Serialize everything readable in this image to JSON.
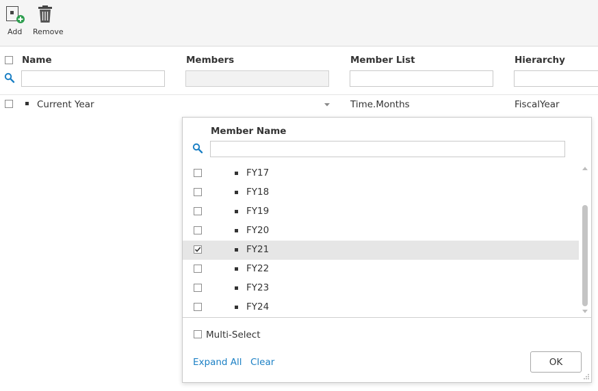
{
  "toolbar": {
    "add_label": "Add",
    "remove_label": "Remove"
  },
  "grid": {
    "columns": [
      "Name",
      "Members",
      "Member List",
      "Hierarchy"
    ],
    "row": {
      "name": "Current Year",
      "members": "",
      "member_list": "Time.Months",
      "hierarchy": "FiscalYear"
    }
  },
  "popup": {
    "title": "Member Name",
    "search_value": "",
    "items": [
      {
        "label": "FY17",
        "checked": false
      },
      {
        "label": "FY18",
        "checked": false
      },
      {
        "label": "FY19",
        "checked": false
      },
      {
        "label": "FY20",
        "checked": false
      },
      {
        "label": "FY21",
        "checked": true
      },
      {
        "label": "FY22",
        "checked": false
      },
      {
        "label": "FY23",
        "checked": false
      },
      {
        "label": "FY24",
        "checked": false
      }
    ],
    "multi_select_label": "Multi-Select",
    "expand_all_label": "Expand All",
    "clear_label": "Clear",
    "ok_label": "OK"
  },
  "colors": {
    "accent": "#1a7fc4",
    "add_badge": "#2e9e4f",
    "selected_row": "#e6e6e6"
  }
}
